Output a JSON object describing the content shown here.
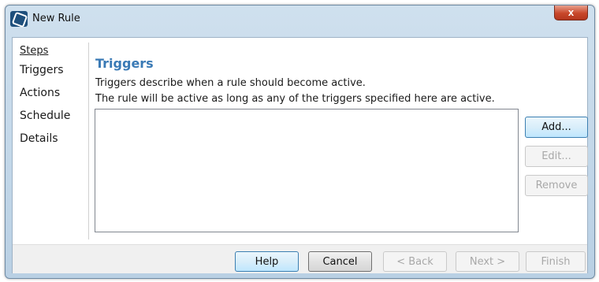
{
  "window": {
    "title": "New Rule",
    "close_label": "x"
  },
  "steps": {
    "header": "Steps",
    "items": [
      {
        "label": "Triggers"
      },
      {
        "label": "Actions"
      },
      {
        "label": "Schedule"
      },
      {
        "label": "Details"
      }
    ]
  },
  "main": {
    "heading": "Triggers",
    "description_line1": "Triggers describe when a rule should become active.",
    "description_line2": "The rule will be active as long as any of the triggers specified here are active.",
    "triggers": []
  },
  "side_buttons": {
    "add": "Add...",
    "edit": "Edit...",
    "remove": "Remove"
  },
  "footer": {
    "help": "Help",
    "cancel": "Cancel",
    "back": "< Back",
    "next": "Next >",
    "finish": "Finish"
  },
  "colors": {
    "heading": "#3a7ab5",
    "close_button": "#c8472a",
    "title_bar": "#cfe0ee"
  }
}
